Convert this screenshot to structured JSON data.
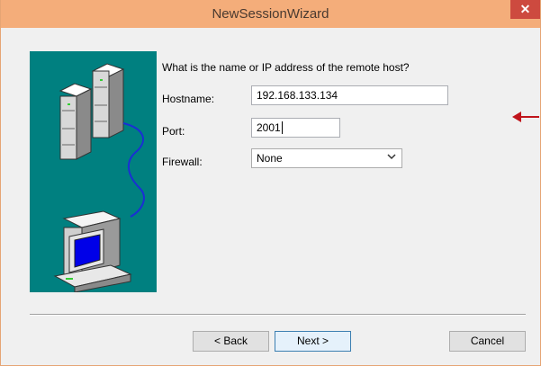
{
  "window": {
    "title": "NewSessionWizard",
    "close_glyph": "✕"
  },
  "form": {
    "prompt": "What is the name or IP address of the remote host?",
    "hostname_label": "Hostname:",
    "hostname_value": "192.168.133.134",
    "port_label": "Port:",
    "port_value": "2001",
    "firewall_label": "Firewall:",
    "firewall_value": "None"
  },
  "buttons": {
    "back": "< Back",
    "next": "Next >",
    "cancel": "Cancel"
  },
  "icons": [
    "server-rack-icon",
    "computer-icon",
    "chevron-down-icon",
    "close-icon",
    "red-arrow-icon"
  ],
  "colors": {
    "titlebar": "#f4ad7a",
    "art_bg": "#008080",
    "close_bg": "#cd4a3f",
    "arrow": "#c0141b"
  }
}
